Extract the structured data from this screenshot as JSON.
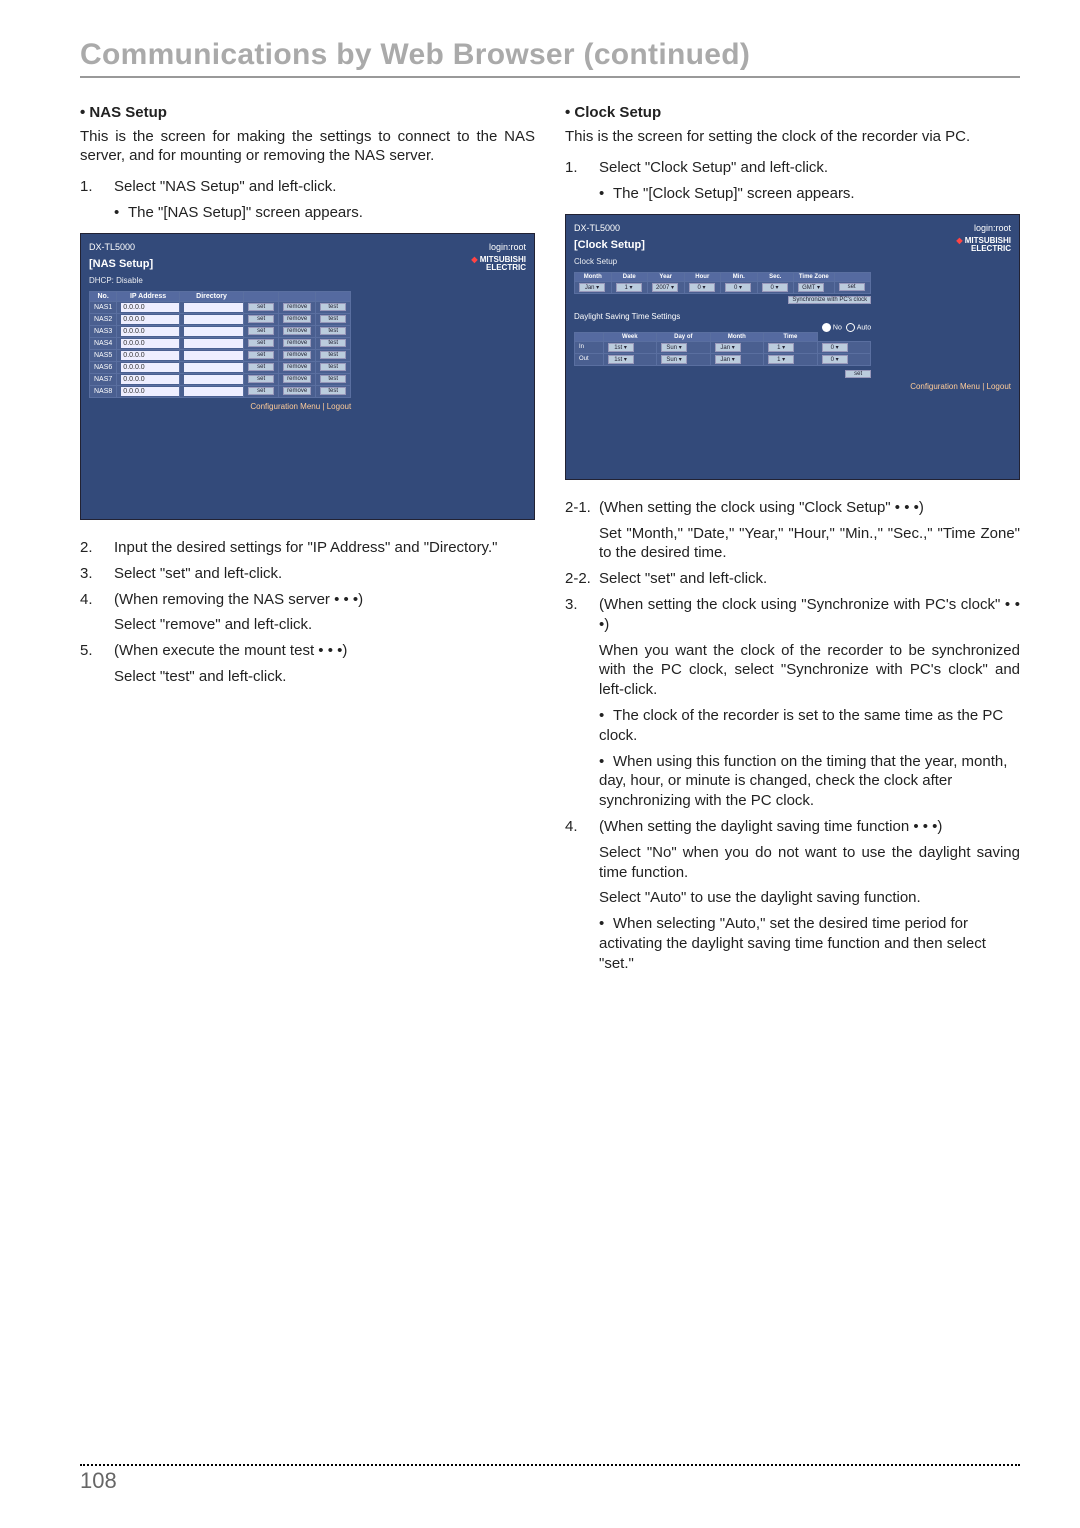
{
  "page_title": "Communications by Web Browser (continued)",
  "page_number": "108",
  "left": {
    "heading": "• NAS Setup",
    "intro": "This is the screen for making the settings to connect to the NAS server, and for mounting or removing the NAS server.",
    "steps_top": [
      {
        "n": "1.",
        "t": "Select \"NAS Setup\" and left-click."
      }
    ],
    "steps_top_sub": "The \"[NAS Setup]\" screen appears.",
    "steps_bottom": [
      {
        "n": "2.",
        "t": "Input the desired settings for \"IP Address\" and \"Directory.\""
      },
      {
        "n": "3.",
        "t": "Select \"set\" and left-click."
      },
      {
        "n": "4.",
        "t": "(When removing the NAS server • • •)"
      },
      {
        "n": "",
        "t": "Select \"remove\" and left-click."
      },
      {
        "n": "5.",
        "t": "(When execute the mount test • • •)"
      },
      {
        "n": "",
        "t": "Select \"test\" and left-click."
      }
    ]
  },
  "right": {
    "heading": "• Clock Setup",
    "intro": "This is the screen for setting the clock of the recorder via PC.",
    "steps_top": [
      {
        "n": "1.",
        "t": "Select \"Clock Setup\" and left-click."
      }
    ],
    "steps_top_sub": "The \"[Clock Setup]\" screen appears.",
    "steps_bottom": [
      {
        "n": "2-1.",
        "t": "(When setting the clock using \"Clock Setup\" • • •)"
      },
      {
        "n": "",
        "t": "Set \"Month,\" \"Date,\" \"Year,\" \"Hour,\" \"Min.,\" \"Sec.,\" \"Time Zone\" to the desired time."
      },
      {
        "n": "2-2.",
        "t": "Select \"set\" and left-click."
      },
      {
        "n": "3.",
        "t": "(When setting the clock using \"Synchronize with PC's clock\" • • •)"
      },
      {
        "n": "",
        "t": "When you want the clock of the recorder to be synchronized with the PC clock, select \"Synchronize with PC's clock\" and left-click."
      }
    ],
    "sub3": [
      "The clock of the recorder is set to the same time as the PC clock.",
      "When using this function on the timing that the year, month, day, hour, or minute is changed, check the clock after synchronizing with the PC clock."
    ],
    "step4_n": "4.",
    "step4_t": "(When setting the daylight saving time function • • •)",
    "step4_p1": "Select \"No\" when you do not want to use the daylight saving time function.",
    "step4_p2": "Select \"Auto\" to use the daylight saving function.",
    "step4_sub": "When selecting \"Auto,\" set the desired time period for activating the daylight saving time function and then select \"set.\""
  },
  "nas_shot": {
    "model": "DX-TL5000",
    "login": "login:root",
    "title": "[NAS Setup]",
    "crumb": "DHCP: Disable",
    "logo1": "MITSUBISHI",
    "logo2": "ELECTRIC",
    "th_no": "No.",
    "th_ip": "IP Address",
    "th_dir": "Directory",
    "btn_set": "set",
    "btn_rem": "remove",
    "btn_test": "test",
    "footer": "Configuration Menu | Logout",
    "rows": [
      {
        "no": "NAS1",
        "ip": "0.0.0.0"
      },
      {
        "no": "NAS2",
        "ip": "0.0.0.0"
      },
      {
        "no": "NAS3",
        "ip": "0.0.0.0"
      },
      {
        "no": "NAS4",
        "ip": "0.0.0.0"
      },
      {
        "no": "NAS5",
        "ip": "0.0.0.0"
      },
      {
        "no": "NAS6",
        "ip": "0.0.0.0"
      },
      {
        "no": "NAS7",
        "ip": "0.0.0.0"
      },
      {
        "no": "NAS8",
        "ip": "0.0.0.0"
      }
    ]
  },
  "clock_shot": {
    "model": "DX-TL5000",
    "login": "login:root",
    "title": "[Clock Setup]",
    "crumb": "Clock Setup",
    "logo1": "MITSUBISHI",
    "logo2": "ELECTRIC",
    "hdr": [
      "Month",
      "Date",
      "Year",
      "Hour",
      "Min.",
      "Sec.",
      "Time Zone",
      ""
    ],
    "vals": [
      "Jan",
      "1",
      "2007",
      "0",
      "0",
      "0",
      "GMT",
      "set"
    ],
    "sync": "Synchronize with PC's clock",
    "dst_head": "Daylight Saving Time Settings",
    "dst_no": "No",
    "dst_auto": "Auto",
    "dst_th": [
      "",
      "Week",
      "Day of",
      "Month",
      "Time"
    ],
    "dst_rows": [
      [
        "In",
        "1st",
        "Sun",
        "Jan",
        "1",
        "0"
      ],
      [
        "Out",
        "1st",
        "Sun",
        "Jan",
        "1",
        "0"
      ]
    ],
    "btn_set": "set",
    "footer": "Configuration Menu | Logout"
  }
}
